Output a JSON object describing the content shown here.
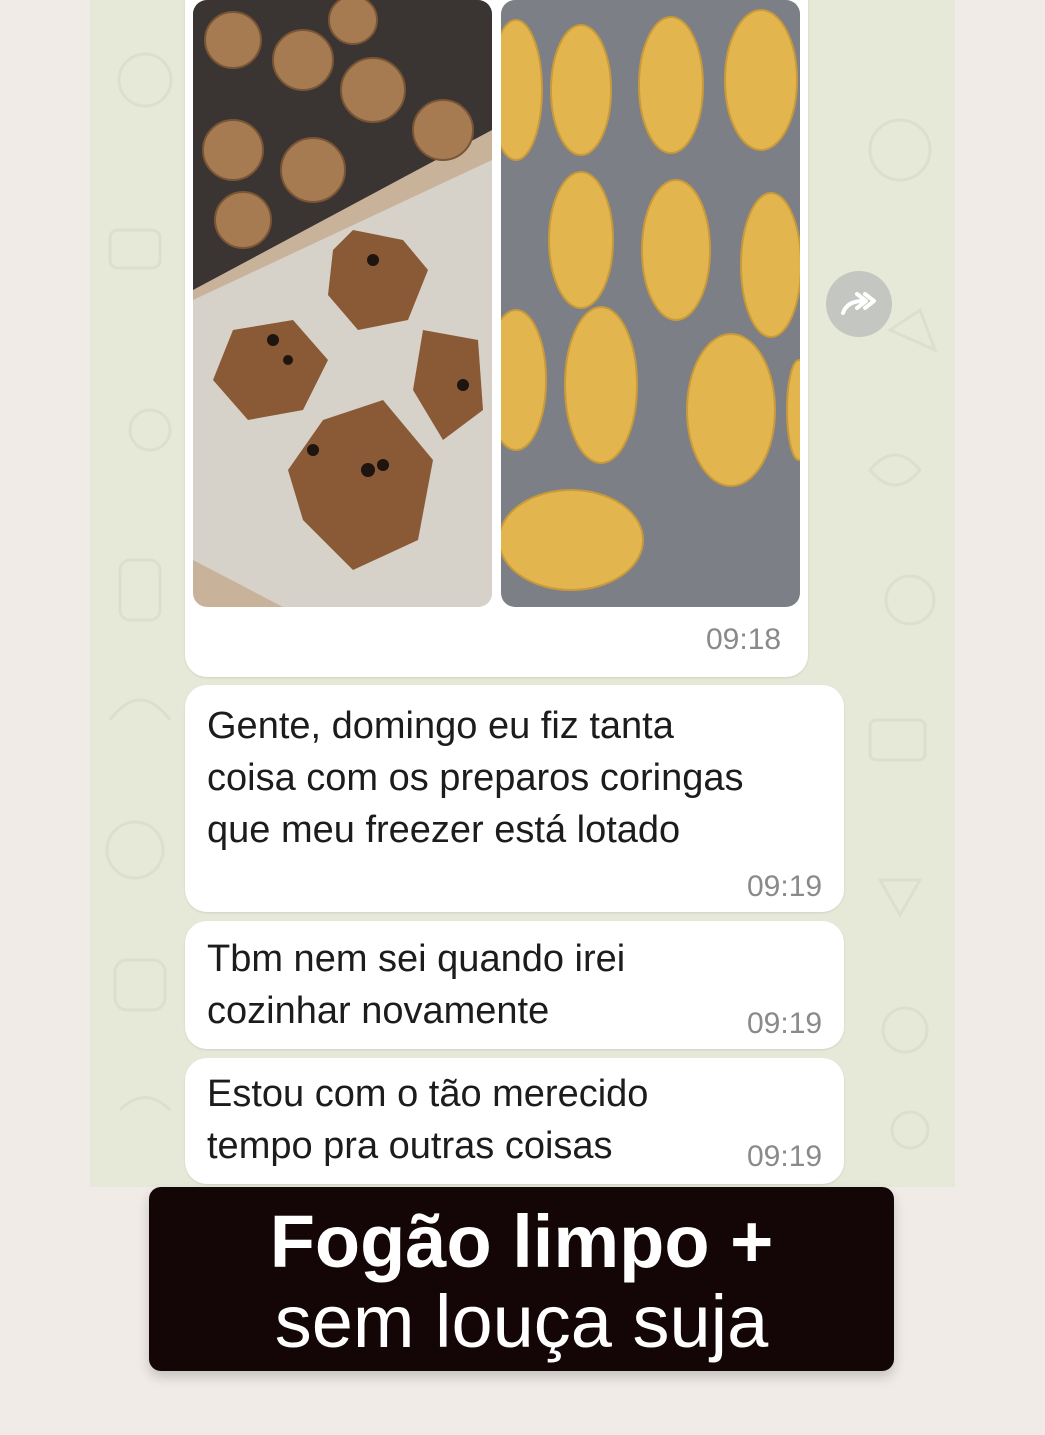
{
  "chat": {
    "photo_message": {
      "time": "09:18",
      "images": [
        {
          "name": "cookies-baking-tray"
        },
        {
          "name": "breaded-croquettes-tray"
        }
      ]
    },
    "messages": [
      {
        "text": "Gente, domingo eu fiz tanta\ncoisa com os preparos coringas\nque meu freezer está lotado",
        "time": "09:19"
      },
      {
        "text": "Tbm nem sei quando irei\ncozinhar novamente",
        "time": "09:19"
      },
      {
        "text": "Estou com o tão merecido\ntempo pra outras coisas",
        "time": "09:19"
      }
    ],
    "forward_icon": "forward-icon"
  },
  "caption": {
    "line1": "Fogão limpo +",
    "line2": "sem louça suja",
    "background": "#140606"
  },
  "colors": {
    "chat_background": "#e6e9d8",
    "page_background": "#f0ebe7",
    "bubble": "#ffffff"
  }
}
